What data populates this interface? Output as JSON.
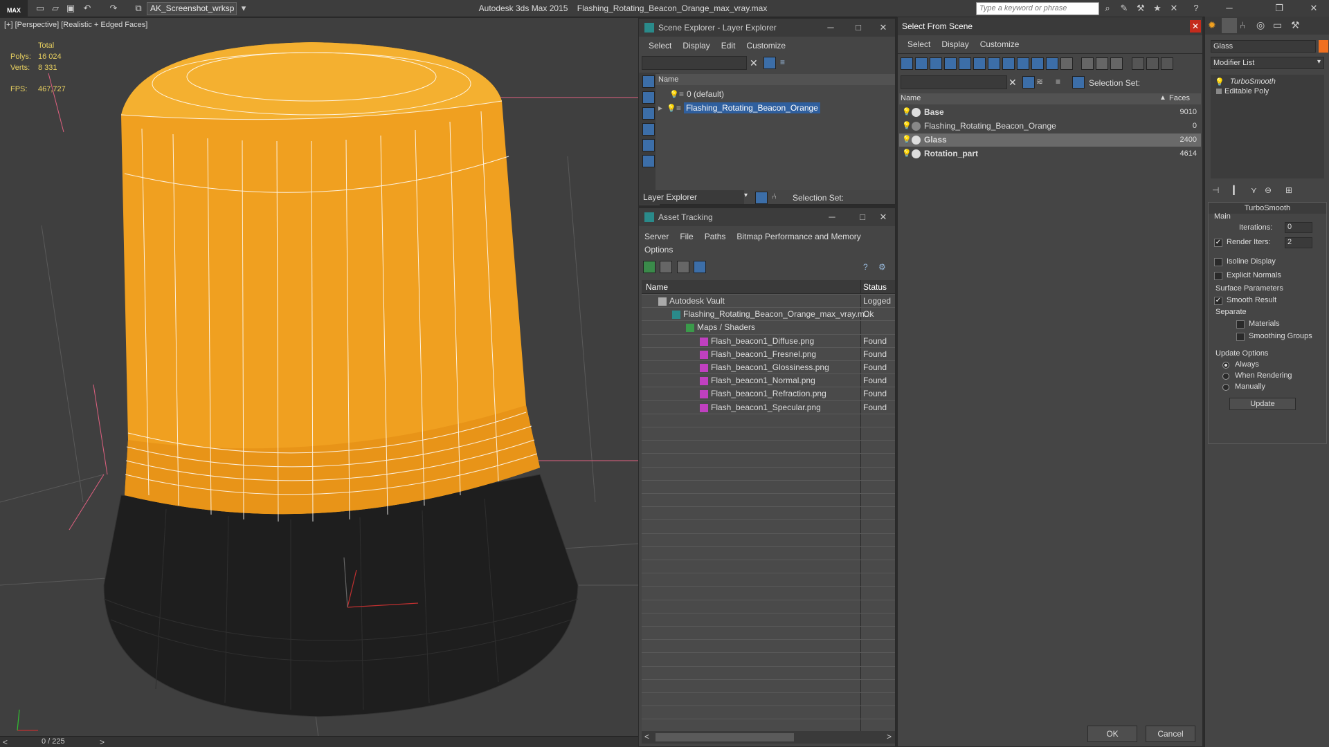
{
  "titlebar": {
    "logo": "MAX",
    "workspace": "AK_Screenshot_wrksp",
    "app_title": "Autodesk 3ds Max  2015",
    "file_title": "Flashing_Rotating_Beacon_Orange_max_vray.max",
    "search_placeholder": "Type a keyword or phrase"
  },
  "viewport": {
    "label": "[+] [Perspective] [Realistic + Edged Faces]",
    "stats": {
      "total_label": "Total",
      "polys_label": "Polys:",
      "polys": "16 024",
      "verts_label": "Verts:",
      "verts": "8 331",
      "fps_label": "FPS:",
      "fps": "467,727"
    },
    "timeline": "0 / 225",
    "prev": "<",
    "next": ">"
  },
  "scene_explorer": {
    "title": "Scene Explorer - Layer Explorer",
    "menu": [
      "Select",
      "Display",
      "Edit",
      "Customize"
    ],
    "col_name": "Name",
    "layers": [
      {
        "label": "0 (default)"
      },
      {
        "label": "Flashing_Rotating_Beacon_Orange"
      }
    ],
    "footer_dropdown": "Layer Explorer",
    "selection_set_label": "Selection Set:"
  },
  "asset_tracking": {
    "title": "Asset Tracking",
    "menu": [
      "Server",
      "File",
      "Paths",
      "Bitmap Performance and Memory"
    ],
    "menu2": "Options",
    "col_name": "Name",
    "col_status": "Status",
    "rows": [
      {
        "name": "Autodesk Vault",
        "status": "Logged"
      },
      {
        "name": "Flashing_Rotating_Beacon_Orange_max_vray.m...",
        "status": "Ok"
      },
      {
        "name": "Maps / Shaders",
        "status": ""
      },
      {
        "name": "Flash_beacon1_Diffuse.png",
        "status": "Found"
      },
      {
        "name": "Flash_beacon1_Fresnel.png",
        "status": "Found"
      },
      {
        "name": "Flash_beacon1_Glossiness.png",
        "status": "Found"
      },
      {
        "name": "Flash_beacon1_Normal.png",
        "status": "Found"
      },
      {
        "name": "Flash_beacon1_Refraction.png",
        "status": "Found"
      },
      {
        "name": "Flash_beacon1_Specular.png",
        "status": "Found"
      }
    ]
  },
  "select_from_scene": {
    "title": "Select From Scene",
    "menu": [
      "Select",
      "Display",
      "Customize"
    ],
    "selection_set_label": "Selection Set:",
    "col_name": "Name",
    "col_faces": "Faces",
    "rows": [
      {
        "name": "Base",
        "faces": "9010"
      },
      {
        "name": "Flashing_Rotating_Beacon_Orange",
        "faces": "0"
      },
      {
        "name": "Glass",
        "faces": "2400"
      },
      {
        "name": "Rotation_part",
        "faces": "4614"
      }
    ],
    "ok": "OK",
    "cancel": "Cancel"
  },
  "command_panel": {
    "object_name": "Glass",
    "modifier_list": "Modifier List",
    "stack": [
      "TurboSmooth",
      "Editable Poly"
    ],
    "rollout_title": "TurboSmooth",
    "main_label": "Main",
    "iterations_label": "Iterations:",
    "iterations": "0",
    "render_iters_label": "Render Iters:",
    "render_iters": "2",
    "isoline": "Isoline Display",
    "explicit": "Explicit Normals",
    "surface_label": "Surface Parameters",
    "smooth_result": "Smooth Result",
    "separate_label": "Separate",
    "materials": "Materials",
    "smoothing_groups": "Smoothing Groups",
    "update_options_label": "Update Options",
    "always": "Always",
    "when_rendering": "When Rendering",
    "manually": "Manually",
    "update_button": "Update"
  },
  "colors": {
    "orange": "#f0a020",
    "selection": "#2f5f9e",
    "panel": "#454545"
  }
}
